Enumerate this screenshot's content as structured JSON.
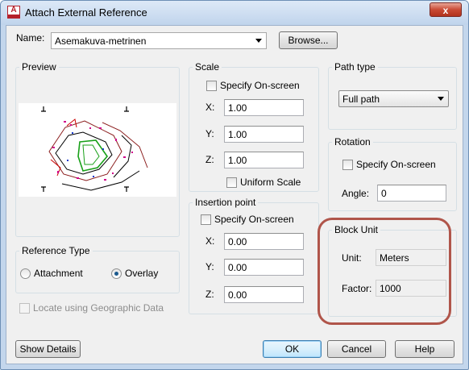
{
  "window": {
    "title": "Attach External Reference",
    "close_glyph": "x"
  },
  "name_row": {
    "label": "Name:",
    "value": "Asemakuva-metrinen",
    "browse_label": "Browse..."
  },
  "preview": {
    "title": "Preview"
  },
  "scale": {
    "title": "Scale",
    "specify_label": "Specify On-screen",
    "specify_checked": false,
    "x_label": "X:",
    "x_value": "1.00",
    "y_label": "Y:",
    "y_value": "1.00",
    "z_label": "Z:",
    "z_value": "1.00",
    "uniform_label": "Uniform Scale",
    "uniform_checked": false
  },
  "insertion": {
    "title": "Insertion point",
    "specify_label": "Specify On-screen",
    "specify_checked": false,
    "x_label": "X:",
    "x_value": "0.00",
    "y_label": "Y:",
    "y_value": "0.00",
    "z_label": "Z:",
    "z_value": "0.00"
  },
  "path_type": {
    "title": "Path type",
    "value": "Full path"
  },
  "rotation": {
    "title": "Rotation",
    "specify_label": "Specify On-screen",
    "specify_checked": false,
    "angle_label": "Angle:",
    "angle_value": "0"
  },
  "block_unit": {
    "title": "Block Unit",
    "unit_label": "Unit:",
    "unit_value": "Meters",
    "factor_label": "Factor:",
    "factor_value": "1000"
  },
  "reference_type": {
    "title": "Reference Type",
    "options": [
      "Attachment",
      "Overlay"
    ],
    "selected": "Overlay"
  },
  "geo": {
    "label": "Locate using Geographic Data",
    "enabled": false
  },
  "buttons": {
    "show_details": "Show Details",
    "ok": "OK",
    "cancel": "Cancel",
    "help": "Help"
  },
  "colors": {
    "highlight": "#b0554a",
    "title_gradient_top": "#dde9f7",
    "close_button": "#c94a34"
  }
}
